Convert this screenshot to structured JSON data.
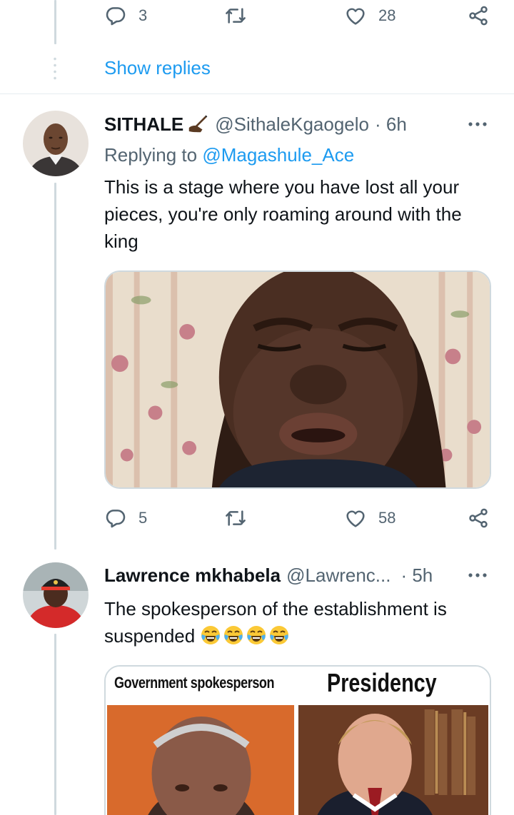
{
  "tweets": [
    {
      "stats": {
        "replies": "3",
        "likes": "28"
      }
    },
    {
      "author_name": "SITHALE",
      "author_handle": "@SithaleKgaogelo",
      "time": "· 6h",
      "replying_label": "Replying to",
      "replying_to": "@Magashule_Ace",
      "text": "This is a stage where you have lost all your pieces, you're only roaming around with the king",
      "stats": {
        "replies": "5",
        "likes": "58"
      }
    },
    {
      "author_name": "Lawrence mkhabela",
      "author_handle": "@Lawrenc...",
      "time": "· 5h",
      "text": "The spokesperson of the establishment is suspended",
      "media_labels": {
        "left": "Government spokesperson",
        "right": "Presidency"
      }
    }
  ],
  "thread": {
    "show_replies": "Show replies"
  },
  "icons": {
    "reply": "reply-icon",
    "retweet": "retweet-icon",
    "like": "heart-icon",
    "share": "share-icon",
    "more": "more-icon",
    "name_emoji": "writing-hand-emoji",
    "text_emoji": "face-with-tears-of-joy-emoji"
  },
  "colors": {
    "accent": "#1d9bf0",
    "secondary_text": "#536471",
    "line": "#cfd9de"
  }
}
